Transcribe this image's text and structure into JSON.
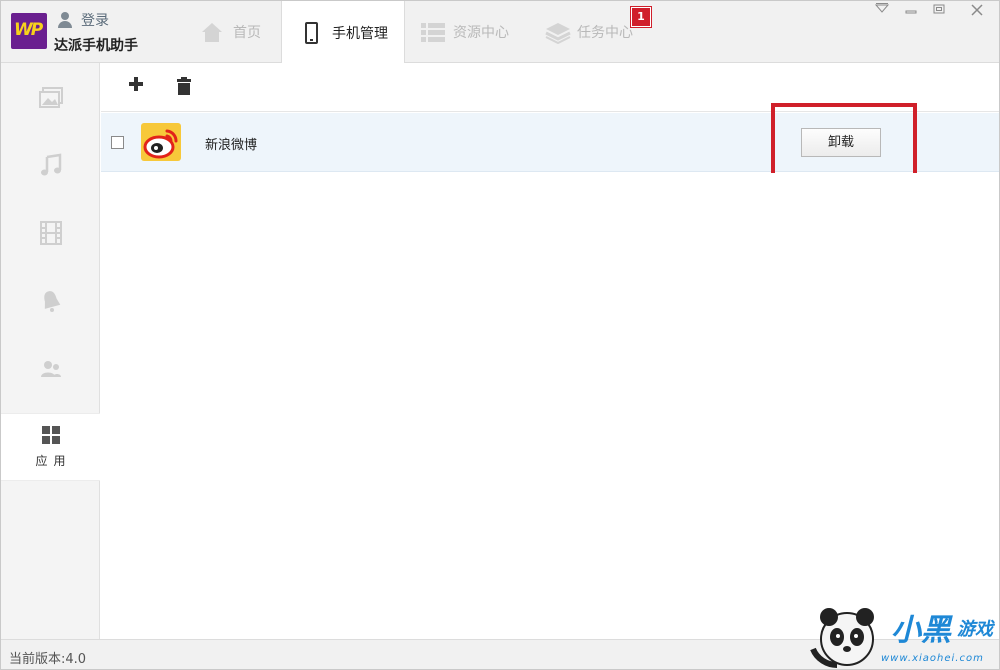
{
  "app": {
    "logo_text": "WP",
    "login_label": "登录",
    "name": "达派手机助手"
  },
  "tabs": {
    "home": "首页",
    "phone": "手机管理",
    "resources": "资源中心",
    "tasks": "任务中心",
    "tasks_badge": "1"
  },
  "sidebar": {
    "active_label": "应用"
  },
  "apps": [
    {
      "name": "新浪微博",
      "action": "卸载"
    }
  ],
  "status": {
    "version": "当前版本:4.0"
  },
  "watermark": {
    "text": "小黑",
    "sub": "游戏",
    "url": "www.xiaohei.com"
  },
  "colors": {
    "accent_purple": "#6a1f8f",
    "badge_red": "#d01f2b",
    "highlight_red": "#d0202a",
    "row_bg": "#eef5fb"
  }
}
